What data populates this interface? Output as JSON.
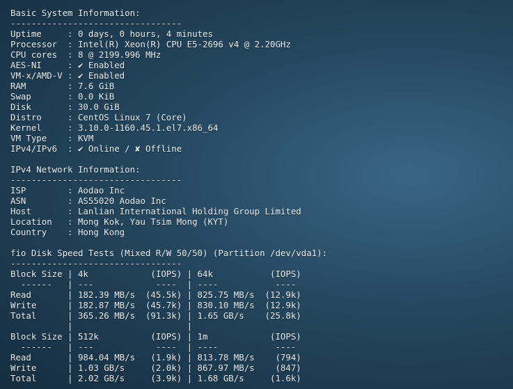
{
  "terminal": {
    "lines": [
      "Basic System Information:",
      "---------------------------------",
      "Uptime     : 0 days, 0 hours, 4 minutes",
      "Processor  : Intel(R) Xeon(R) CPU E5-2696 v4 @ 2.20GHz",
      "CPU cores  : 8 @ 2199.996 MHz",
      "AES-NI     : ✔ Enabled",
      "VM-x/AMD-V : ✔ Enabled",
      "RAM        : 7.6 GiB",
      "Swap       : 0.0 KiB",
      "Disk       : 30.0 GiB",
      "Distro     : CentOS Linux 7 (Core)",
      "Kernel     : 3.10.0-1160.45.1.el7.x86_64",
      "VM Type    : KVM",
      "IPv4/IPv6  : ✔ Online / ✘ Offline",
      "",
      "IPv4 Network Information:",
      "---------------------------------",
      "ISP        : Aodao Inc",
      "ASN        : AS55020 Aodao Inc",
      "Host       : Lanlian International Holding Group Limited",
      "Location   : Mong Kok, Yau Tsim Mong (KYT)",
      "Country    : Hong Kong",
      "",
      "fio Disk Speed Tests (Mixed R/W 50/50) (Partition /dev/vda1):",
      "---------------------------------",
      "Block Size | 4k            (IOPS) | 64k           (IOPS)",
      "  ------   | ---            ----  | ----           ----",
      "Read       | 182.39 MB/s  (45.5k) | 825.75 MB/s  (12.9k)",
      "Write      | 182.87 MB/s  (45.7k) | 830.10 MB/s  (12.9k)",
      "Total      | 365.26 MB/s  (91.3k) | 1.65 GB/s    (25.8k)",
      "           |                      |",
      "Block Size | 512k          (IOPS) | 1m            (IOPS)",
      "  ------   | ---            ----  | ----           ----",
      "Read       | 984.04 MB/s   (1.9k) | 813.78 MB/s    (794)",
      "Write      | 1.03 GB/s     (2.0k) | 867.97 MB/s    (847)",
      "Total      | 2.02 GB/s     (3.9k) | 1.68 GB/s     (1.6k)"
    ]
  }
}
